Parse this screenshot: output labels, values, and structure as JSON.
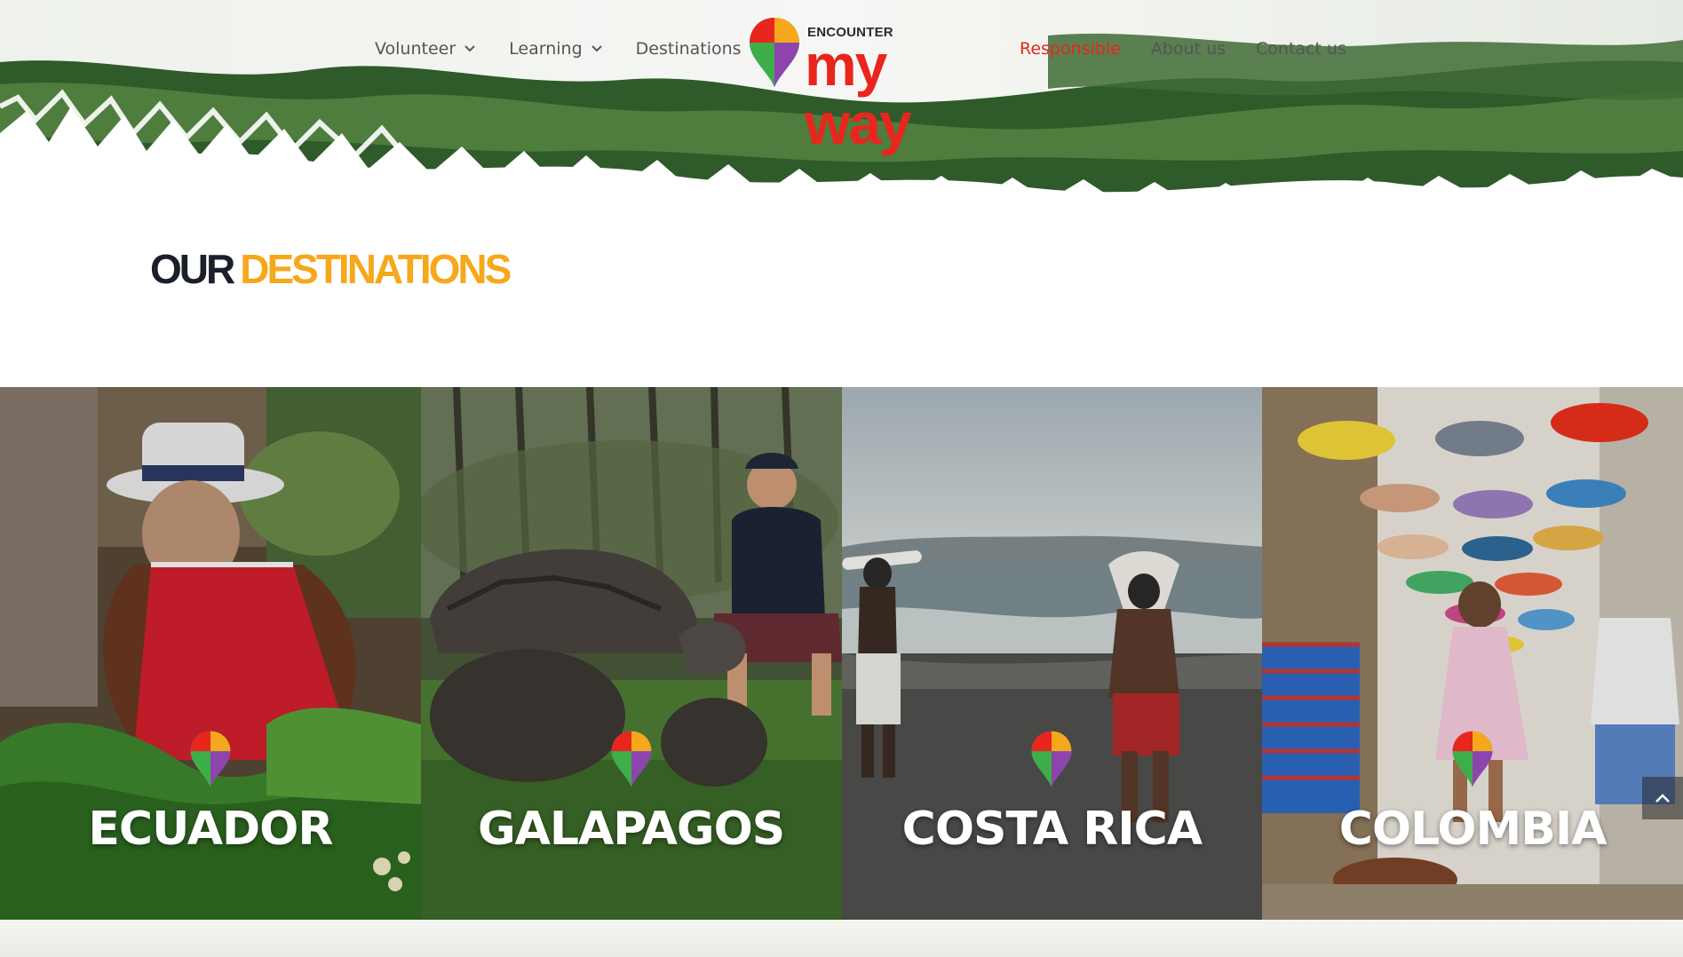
{
  "nav": {
    "left": [
      {
        "label": "Volunteer",
        "has_dropdown": true
      },
      {
        "label": "Learning",
        "has_dropdown": true
      },
      {
        "label": "Destinations",
        "has_dropdown": true
      }
    ],
    "right": [
      {
        "label": "Responsible",
        "active": true
      },
      {
        "label": "About us"
      },
      {
        "label": "Contact us"
      }
    ]
  },
  "logo": {
    "small": "ENCOUNTER",
    "big": "my way"
  },
  "title": {
    "word1": "OUR",
    "word2": "DESTINATIONS"
  },
  "destinations": [
    {
      "label": "ECUADOR"
    },
    {
      "label": "GALAPAGOS"
    },
    {
      "label": "COSTA RICA"
    },
    {
      "label": "COLOMBIA"
    }
  ],
  "colors": {
    "accent_red": "#e8261e",
    "accent_orange": "#f5a81c",
    "title_dark": "#1a1f2a",
    "nav_text": "#555555"
  },
  "icons": {
    "scroll_top": "chevron-up-icon",
    "dropdown": "chevron-down-icon",
    "pin": "map-pin-icon"
  }
}
